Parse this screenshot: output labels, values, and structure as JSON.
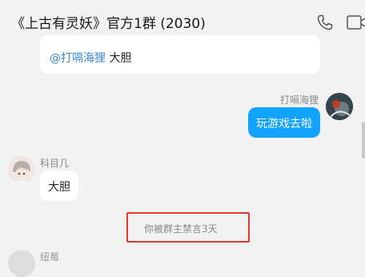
{
  "header": {
    "title": "《上古有灵妖》官方1群 (2030)",
    "call_icon": "phone-icon",
    "video_icon": "video-camera-icon"
  },
  "messages": {
    "previous": {
      "mention": "@打嗝海狸",
      "text": " 大胆"
    },
    "self": {
      "sender": "打嗝海狸",
      "text": "玩游戏去啦"
    },
    "other": {
      "sender": "科目几",
      "text": "大胆"
    },
    "system": {
      "text": "你被群主禁言3天"
    },
    "next": {
      "sender": "纽莓"
    }
  },
  "colors": {
    "accent": "#12a3ff",
    "mention": "#3a86d6",
    "highlight_box": "#e4382c",
    "background": "#f2f2f2"
  }
}
